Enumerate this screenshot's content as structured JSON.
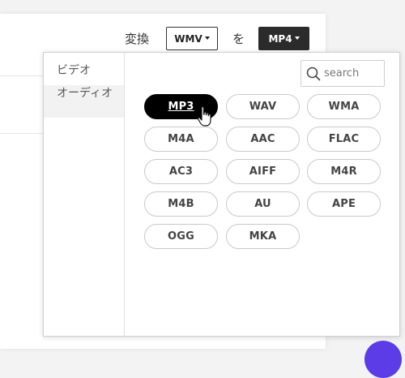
{
  "toolbar": {
    "convert_label": "変換",
    "source_format": "WMV",
    "to_label": "を",
    "target_format": "MP4"
  },
  "dropdown": {
    "categories": [
      {
        "label": "ビデオ",
        "active": false
      },
      {
        "label": "オーディオ",
        "active": true
      }
    ],
    "search": {
      "placeholder": "search",
      "value": ""
    },
    "formats": [
      "MP3",
      "WAV",
      "WMA",
      "M4A",
      "AAC",
      "FLAC",
      "AC3",
      "AIFF",
      "M4R",
      "M4B",
      "AU",
      "APE",
      "OGG",
      "MKA"
    ],
    "selected_format": "MP3"
  },
  "colors": {
    "selected_bg": "#000000",
    "target_select_bg": "#2b2b2b",
    "fab": "#5b3ce6"
  }
}
